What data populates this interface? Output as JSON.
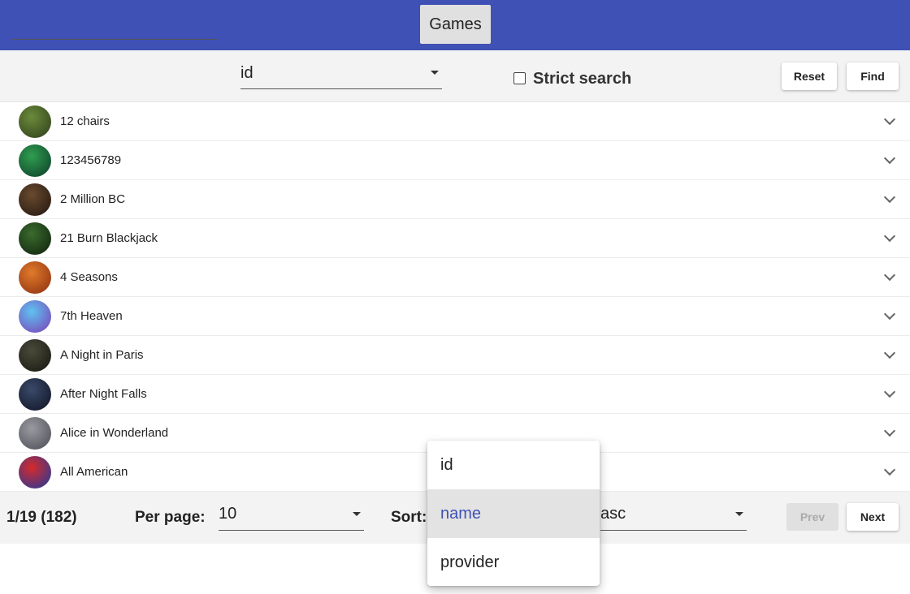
{
  "header": {
    "tab_label": "Games",
    "accent_color": "#3f51b5"
  },
  "filter": {
    "search_value": "",
    "field_select_value": "id",
    "strict_label": "Strict search",
    "strict_checked": false,
    "reset_label": "Reset",
    "find_label": "Find"
  },
  "games": [
    {
      "name": "12 chairs",
      "avatar_colors": [
        "#6b8a3a",
        "#2c3d1a"
      ]
    },
    {
      "name": "123456789",
      "avatar_colors": [
        "#2f9e4f",
        "#0d3b2a"
      ]
    },
    {
      "name": "2 Million BC",
      "avatar_colors": [
        "#6a4a2e",
        "#1f1510"
      ]
    },
    {
      "name": "21 Burn Blackjack",
      "avatar_colors": [
        "#3b6b2d",
        "#0d200c"
      ]
    },
    {
      "name": "4 Seasons",
      "avatar_colors": [
        "#e07a2a",
        "#8a2d10"
      ]
    },
    {
      "name": "7th Heaven",
      "avatar_colors": [
        "#5fc2f0",
        "#7b3bb5"
      ]
    },
    {
      "name": "A Night in Paris",
      "avatar_colors": [
        "#4a4a3a",
        "#151510"
      ]
    },
    {
      "name": "After Night Falls",
      "avatar_colors": [
        "#3a4a6a",
        "#0d1220"
      ]
    },
    {
      "name": "Alice in Wonderland",
      "avatar_colors": [
        "#9a9aa0",
        "#4a4a55"
      ]
    },
    {
      "name": "All American",
      "avatar_colors": [
        "#d62a2a",
        "#1a3aa0"
      ]
    }
  ],
  "footer": {
    "page_info": "1/19 (182)",
    "per_page_label": "Per page:",
    "per_page_value": "10",
    "sort_label": "Sort:",
    "order_value": "asc",
    "prev_label": "Prev",
    "next_label": "Next"
  },
  "sort_dropdown": {
    "options": [
      "id",
      "name",
      "provider"
    ],
    "selected": "name"
  }
}
